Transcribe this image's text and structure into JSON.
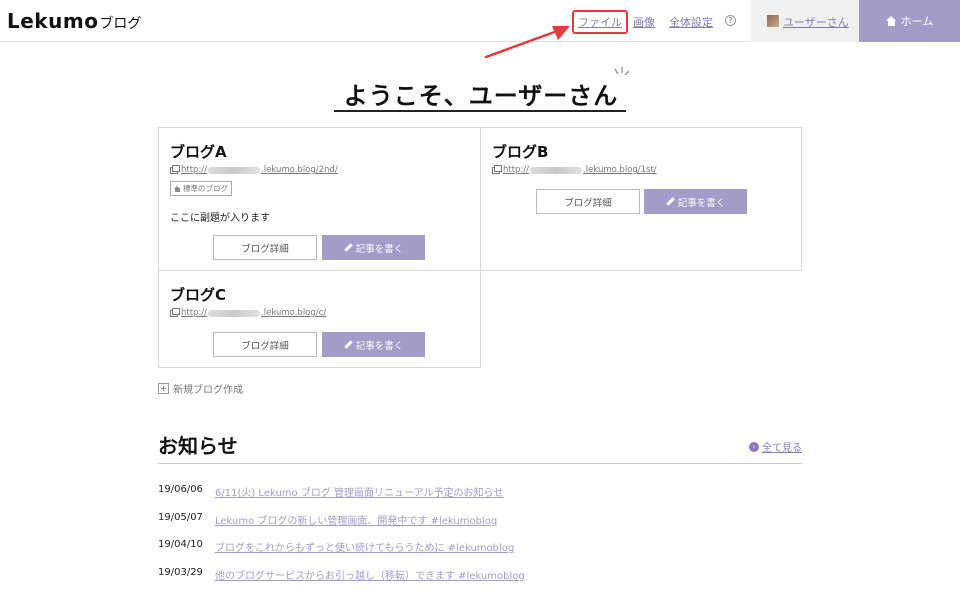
{
  "header": {
    "brand": "Lekumo",
    "brand_sub": "ブログ",
    "nav": {
      "file": "ファイル",
      "images": "画像",
      "settings": "全体設定",
      "help": "?"
    },
    "user_name": "ユーザーさん",
    "home": "ホーム"
  },
  "welcome": "ようこそ、ユーザーさん",
  "blogs": [
    {
      "title": "ブログA",
      "url_prefix": "http://",
      "url_suffix": ".lekumo.blog/2nd/",
      "badge": "標準のブログ",
      "subtitle": "ここに副題が入ります",
      "detail_label": "ブログ詳細",
      "write_label": "記事を書く"
    },
    {
      "title": "ブログB",
      "url_prefix": "http://",
      "url_suffix": ".lekumo.blog/1st/",
      "detail_label": "ブログ詳細",
      "write_label": "記事を書く"
    },
    {
      "title": "ブログC",
      "url_prefix": "http://",
      "url_suffix": ".lekumo.blog/c/",
      "detail_label": "ブログ詳細",
      "write_label": "記事を書く"
    }
  ],
  "new_blog": "新規ブログ作成",
  "news": {
    "heading": "お知らせ",
    "view_all": "全て見る",
    "items": [
      {
        "date": "19/06/06",
        "title": "6/11(火) Lekumo ブログ 管理画面リニューアル予定のお知らせ"
      },
      {
        "date": "19/05/07",
        "title": "Lekumo ブログの新しい管理画面、開発中です #lekumoblog"
      },
      {
        "date": "19/04/10",
        "title": "ブログをこれからもずっと使い続けてもらうために #lekumoblog"
      },
      {
        "date": "19/03/29",
        "title": "他のブログサービスからお引っ越し（移転）できます #lekumoblog"
      }
    ]
  },
  "colors": {
    "accent": "#a59bc8",
    "link": "#8878b8",
    "annotation": "#e23b3b"
  }
}
